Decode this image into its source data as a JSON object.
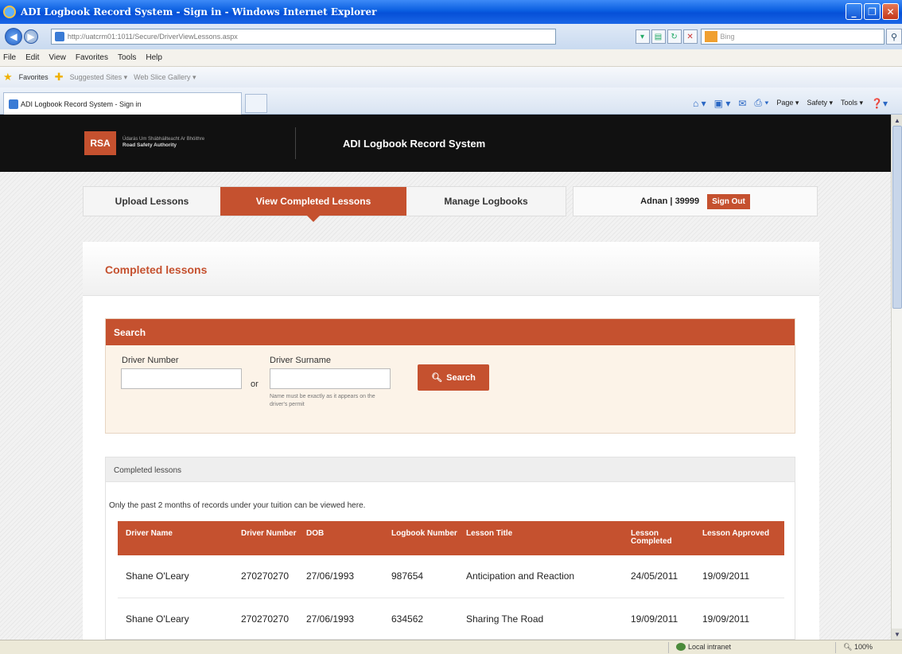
{
  "browser": {
    "window_title": "ADI Logbook Record System - Sign in - Windows Internet Explorer",
    "url": "http://uatcrm01:1011/Secure/DriverViewLessons.aspx",
    "search_placeholder": "Bing",
    "menu": [
      "File",
      "Edit",
      "View",
      "Favorites",
      "Tools",
      "Help"
    ],
    "favorites_label": "Favorites",
    "suggested_sites": "Suggested Sites ▾",
    "web_slice_gallery": "Web Slice Gallery ▾",
    "tab_title": "ADI Logbook Record System - Sign in",
    "commands": [
      "Page ▾",
      "Safety ▾",
      "Tools ▾"
    ],
    "status_zone": "Local intranet",
    "zoom": "100%"
  },
  "site": {
    "logo": "RSA",
    "org_irish": "Údarás Um Shábháilteacht Ar Bhóithre",
    "org_english": "Road Safety Authority",
    "app_title": "ADI Logbook Record System"
  },
  "nav": {
    "tabs": [
      {
        "label": "Upload Lessons"
      },
      {
        "label": "View Completed Lessons"
      },
      {
        "label": "Manage Logbooks"
      }
    ],
    "user": "Adnan | 39999",
    "signout": "Sign Out"
  },
  "page": {
    "heading": "Completed lessons"
  },
  "search": {
    "title": "Search",
    "driver_number_label": "Driver Number",
    "or": "or",
    "driver_surname_label": "Driver Surname",
    "hint": "Name must be exactly as it appears on the driver's permit",
    "button": "Search"
  },
  "results": {
    "title": "Completed lessons",
    "note": "Only the past 2 months of records under your tuition can be viewed here.",
    "columns": [
      "Driver Name",
      "Driver Number",
      "DOB",
      "Logbook Number",
      "Lesson Title",
      "Lesson Completed",
      "Lesson Approved"
    ],
    "rows": [
      [
        "Shane O'Leary",
        "270270270",
        "27/06/1993",
        "987654",
        "Anticipation and Reaction",
        "24/05/2011",
        "19/09/2011"
      ],
      [
        "Shane O'Leary",
        "270270270",
        "27/06/1993",
        "634562",
        "Sharing The Road",
        "19/09/2011",
        "19/09/2011"
      ]
    ]
  },
  "colors": {
    "accent": "#c5512f",
    "header_bg": "#111111",
    "search_bg": "#fcf3e8"
  }
}
